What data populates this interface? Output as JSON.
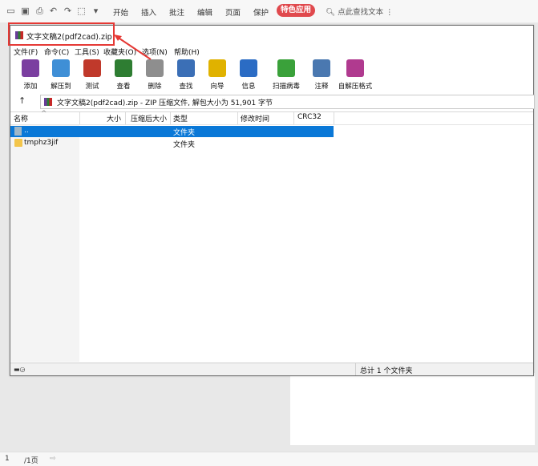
{
  "ribbon": {
    "tabs": [
      "开始",
      "插入",
      "批注",
      "编辑",
      "页面",
      "保护"
    ],
    "special": "特色应用",
    "search": "点此查找文本"
  },
  "window": {
    "title": "文字文稿2(pdf2cad).zip",
    "menu": [
      "文件(F)",
      "命令(C)",
      "工具(S)",
      "收藏夹(O)",
      "选项(N)",
      "帮助(H)"
    ],
    "toolbar": [
      {
        "label": "添加",
        "icon": "add-archive-icon",
        "color": "#7b3fa0"
      },
      {
        "label": "解压到",
        "icon": "extract-folder-icon",
        "color": "#3f8fd6"
      },
      {
        "label": "测试",
        "icon": "test-clipboard-icon",
        "color": "#c0392b"
      },
      {
        "label": "查看",
        "icon": "view-book-icon",
        "color": "#2e7d32"
      },
      {
        "label": "删除",
        "icon": "delete-trash-icon",
        "color": "#8e8e8e"
      },
      {
        "label": "查找",
        "icon": "find-magnifier-icon",
        "color": "#3b6fb6"
      },
      {
        "label": "向导",
        "icon": "wizard-wand-icon",
        "color": "#e0b200"
      },
      {
        "label": "信息",
        "icon": "info-icon",
        "color": "#2b6cc4"
      },
      {
        "label": "扫描病毒",
        "icon": "virus-scan-icon",
        "color": "#3aa13a"
      },
      {
        "label": "注释",
        "icon": "comment-icon",
        "color": "#4a78b0"
      },
      {
        "label": "自解压格式",
        "icon": "sfx-archive-icon",
        "color": "#b03a8f"
      }
    ],
    "address": "文字文稿2(pdf2cad).zip - ZIP 压缩文件, 解包大小为 51,901 字节",
    "columns": [
      "名称",
      "大小",
      "压缩后大小",
      "类型",
      "修改时间",
      "CRC32"
    ],
    "rows": [
      {
        "name": "..",
        "type": "文件夹"
      },
      {
        "name": "tmphz3jif",
        "type": "文件夹"
      }
    ],
    "status_total": "总计 1 个文件夹"
  },
  "bottom": {
    "page": "1",
    "total": "/1页"
  },
  "colors": {
    "accent": "#e0494d",
    "selection": "#0a78d7",
    "highlight": "#e53935"
  }
}
